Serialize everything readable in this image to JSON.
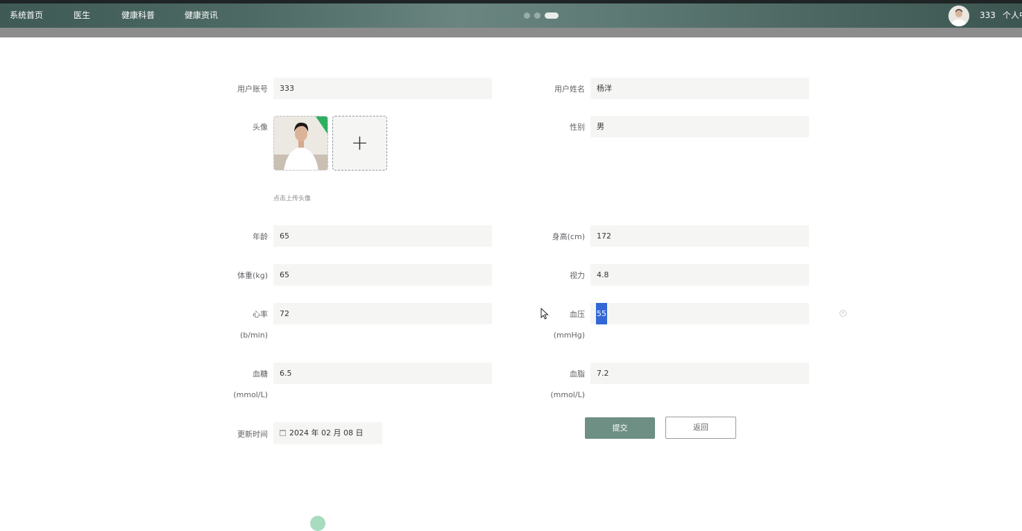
{
  "nav": {
    "items": [
      "系统首页",
      "医生",
      "健康科普",
      "健康资讯"
    ],
    "username": "333",
    "personal_center": "个人中心"
  },
  "form": {
    "account": {
      "label": "用户账号",
      "value": "333"
    },
    "name": {
      "label": "用户姓名",
      "value": "杨洋"
    },
    "avatar": {
      "label": "头像",
      "hint": "点击上传头像"
    },
    "gender": {
      "label": "性别",
      "value": "男"
    },
    "age": {
      "label": "年龄",
      "value": "65"
    },
    "height": {
      "label": "身高(cm)",
      "value": "172"
    },
    "weight": {
      "label": "体重(kg)",
      "value": "65"
    },
    "vision": {
      "label": "视力",
      "value": "4.8"
    },
    "heart_rate": {
      "label": "心率",
      "unit": "(b/min)",
      "value": "72"
    },
    "blood_pressure": {
      "label": "血压",
      "unit": "(mmHg)",
      "value": "55"
    },
    "blood_sugar": {
      "label": "血糖",
      "unit": "(mmol/L)",
      "value": "6.5"
    },
    "blood_lipid": {
      "label": "血脂",
      "unit": "(mmol/L)",
      "value": "7.2"
    },
    "update_time": {
      "label": "更新时间",
      "value": "2024 年 02 月 08 日"
    }
  },
  "buttons": {
    "submit": "提交",
    "back": "返回"
  },
  "icons": [
    "calendar-icon",
    "plus-icon",
    "clear-icon",
    "cursor-icon"
  ],
  "colors": {
    "nav_bg": "#4d6a64",
    "submit_bg": "#6e8f83",
    "selection": "#3367d6"
  }
}
